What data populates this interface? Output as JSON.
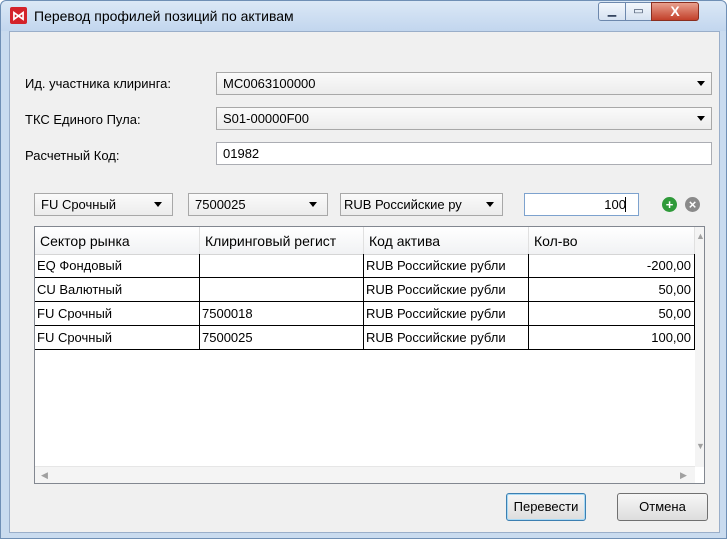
{
  "window": {
    "title": "Перевод профилей позиций по активам",
    "icon_glyph": "⋈",
    "minimize_glyph": "▁",
    "maximize_glyph": "▭",
    "close_glyph": "X"
  },
  "form": {
    "participant_label": "Ид. участника клиринга:",
    "participant_value": "MC0063100000",
    "pool_label": "ТКС Единого Пула:",
    "pool_value": "S01-00000F00",
    "code_label": "Расчетный Код:",
    "code_value": "01982"
  },
  "filters": {
    "sector_value": "FU Срочный",
    "register_value": "7500025",
    "asset_value": "RUB Российские ру",
    "quantity_value": "100",
    "add_glyph": "+",
    "remove_glyph": "×"
  },
  "table": {
    "columns": [
      "Сектор рынка",
      "Клиринговый регист",
      "Код актива",
      "Кол-во"
    ],
    "rows": [
      {
        "sector": "EQ Фондовый",
        "register": "",
        "asset": "RUB Российские рубли",
        "qty": "-200,00"
      },
      {
        "sector": "CU Валютный",
        "register": "",
        "asset": "RUB Российские рубли",
        "qty": "50,00"
      },
      {
        "sector": "FU Срочный",
        "register": "7500018",
        "asset": "RUB Российские рубли",
        "qty": "50,00"
      },
      {
        "sector": "FU Срочный",
        "register": "7500025",
        "asset": "RUB Российские рубли",
        "qty": "100,00"
      }
    ],
    "scroll_up_glyph": "▲",
    "scroll_down_glyph": "▼",
    "scroll_left_glyph": "◀",
    "scroll_right_glyph": "▶"
  },
  "buttons": {
    "transfer_label": "Перевести",
    "cancel_label": "Отмена"
  },
  "colors": {
    "add_button": "#2f9a3a",
    "remove_button": "#8a8a8a",
    "close_button": "#c2402a"
  }
}
